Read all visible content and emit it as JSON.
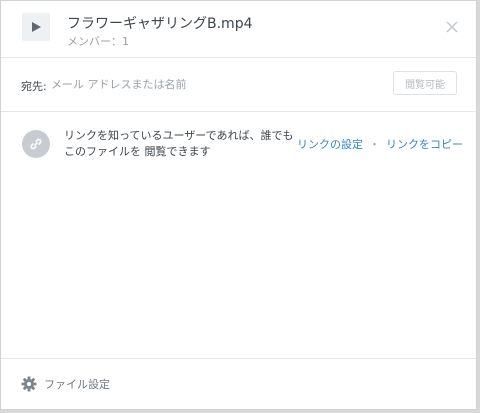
{
  "header": {
    "file_name": "フラワーギャザリングB.mp4",
    "members": "メンバー：1"
  },
  "share": {
    "to_label": "宛先:",
    "to_placeholder": "メール アドレスまたは名前",
    "permission_label": "閲覧可能"
  },
  "link": {
    "description": "リンクを知っているユーザーであれば、誰でもこのファイルを 閲覧できます",
    "settings_label": "リンクの設定",
    "separator": "・",
    "copy_label": "リンクをコピー"
  },
  "footer": {
    "file_settings_label": "ファイル設定"
  },
  "icons": {
    "file": "play-icon",
    "close": "close-icon",
    "link": "link-icon",
    "settings": "gear-icon"
  }
}
